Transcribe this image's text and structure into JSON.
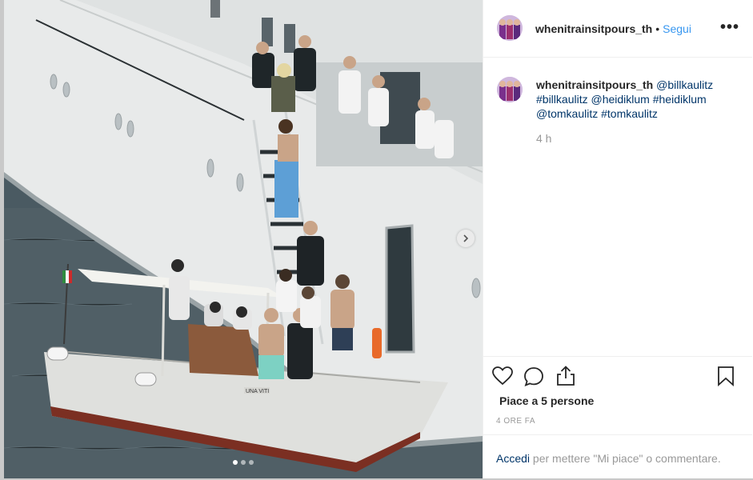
{
  "post": {
    "username": "whenitrainsitpours_th",
    "separator": "•",
    "follow_label": "Segui",
    "more_label": "•••",
    "caption_username": "whenitrainsitpours_th",
    "caption_parts": [
      "@billkaulitz",
      "#billkaulitz",
      "@heidiklum",
      "#heidiklum",
      "@tomkaulitz",
      "#tomkaulitz"
    ],
    "caption_time": "4 h",
    "likes_text": "Piace a 5 persone",
    "time_ago": "4 ORE FA",
    "login_link": "Accedi",
    "login_rest": " per mettere \"Mi piace\" o commentare.",
    "boat_name": "UNA VITI"
  },
  "carousel": {
    "dot_count": 3,
    "active_index": 0
  },
  "icons": {
    "like": "heart-icon",
    "comment": "comment-icon",
    "share": "share-icon",
    "save": "bookmark-icon",
    "next": "chevron-right-icon"
  },
  "colors": {
    "link": "#003569",
    "follow": "#3897f0",
    "text": "#262626",
    "muted": "#999999",
    "flag_green": "#2e8b3e",
    "flag_red": "#cc2a2a"
  }
}
